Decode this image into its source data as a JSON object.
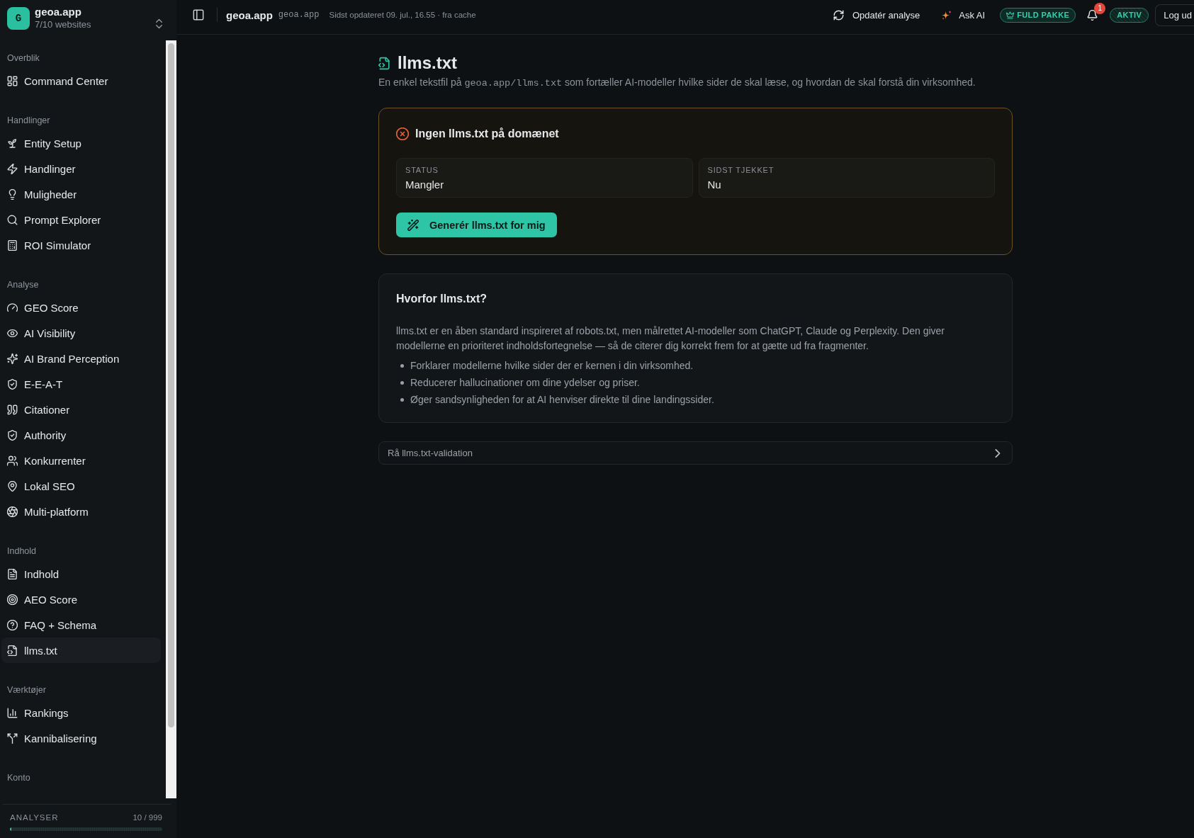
{
  "sidebar": {
    "workspace": {
      "logo": "G",
      "name": "geoa.app",
      "subtitle": "7/10 websites"
    },
    "sections": [
      {
        "title": "Overblik",
        "items": [
          {
            "label": "Command Center",
            "selected": false
          }
        ]
      },
      {
        "title": "Handlinger",
        "items": [
          {
            "label": "Entity Setup",
            "selected": false
          },
          {
            "label": "Handlinger",
            "selected": false
          },
          {
            "label": "Muligheder",
            "selected": false
          },
          {
            "label": "Prompt Explorer",
            "selected": false
          },
          {
            "label": "ROI Simulator",
            "selected": false
          }
        ]
      },
      {
        "title": "Analyse",
        "items": [
          {
            "label": "GEO Score",
            "selected": false
          },
          {
            "label": "AI Visibility",
            "selected": false
          },
          {
            "label": "AI Brand Perception",
            "selected": false
          },
          {
            "label": "E-E-A-T",
            "selected": false
          },
          {
            "label": "Citationer",
            "selected": false
          },
          {
            "label": "Authority",
            "selected": false
          },
          {
            "label": "Konkurrenter",
            "selected": false
          },
          {
            "label": "Lokal SEO",
            "selected": false
          },
          {
            "label": "Multi-platform",
            "selected": false
          }
        ]
      },
      {
        "title": "Indhold",
        "items": [
          {
            "label": "Indhold",
            "selected": false
          },
          {
            "label": "AEO Score",
            "selected": false
          },
          {
            "label": "FAQ + Schema",
            "selected": false
          },
          {
            "label": "llms.txt",
            "selected": true
          }
        ]
      },
      {
        "title": "Værktøjer",
        "items": [
          {
            "label": "Rankings",
            "selected": false
          },
          {
            "label": "Kannibalisering",
            "selected": false
          }
        ]
      },
      {
        "title": "Konto"
      }
    ],
    "usage": {
      "label": "ANALYSER",
      "reading": "10 / 999",
      "level": 0.01
    }
  },
  "topbar": {
    "site_name": "geoa.app",
    "domain": "geoa.app",
    "updated": "Sidst opdateret 09. jul., 16.55 · fra cache",
    "refresh_button": "Opdatér analyse",
    "ask_ai_button": "Ask AI",
    "plan_badge": "FULD PAKKE",
    "notifications": {
      "count": "1"
    },
    "status_badge": "AKTIV",
    "logout_button": "Log ud"
  },
  "page": {
    "title": "llms.txt",
    "subtitle": [
      {
        "kind": "text",
        "text": "En enkel tekstfil på "
      },
      {
        "kind": "code",
        "text": "geoa.app/llms.txt"
      },
      {
        "kind": "text",
        "text": " som fortæller AI-modeller hvilke sider de skal læse, og hvordan de skal forstå din virksomhed."
      }
    ],
    "status_card": {
      "heading": "Ingen llms.txt på domænet",
      "stats": [
        {
          "label": "STATUS",
          "value": "Mangler"
        },
        {
          "label": "SIDST TJEKKET",
          "value": "Nu"
        }
      ],
      "button": "Generér llms.txt for mig"
    },
    "info_card": {
      "heading": "Hvorfor llms.txt?",
      "paragraph": "llms.txt er en åben standard inspireret af robots.txt, men målrettet AI-modeller som ChatGPT, Claude og Perplexity. Den giver modellerne en prioriteret indholdsfortegnelse — så de citerer dig korrekt frem for at gætte ud fra fragmenter.",
      "bullets": [
        "Forklarer modellerne hvilke sider der er kernen i din virksomhed.",
        "Reducerer hallucinationer om dine ydelser og priser.",
        "Øger sandsynligheden for at AI henviser direkte til dine landingssider."
      ]
    },
    "validation_panel": {
      "title": "Rå llms.txt-validation",
      "expanded": false
    }
  }
}
